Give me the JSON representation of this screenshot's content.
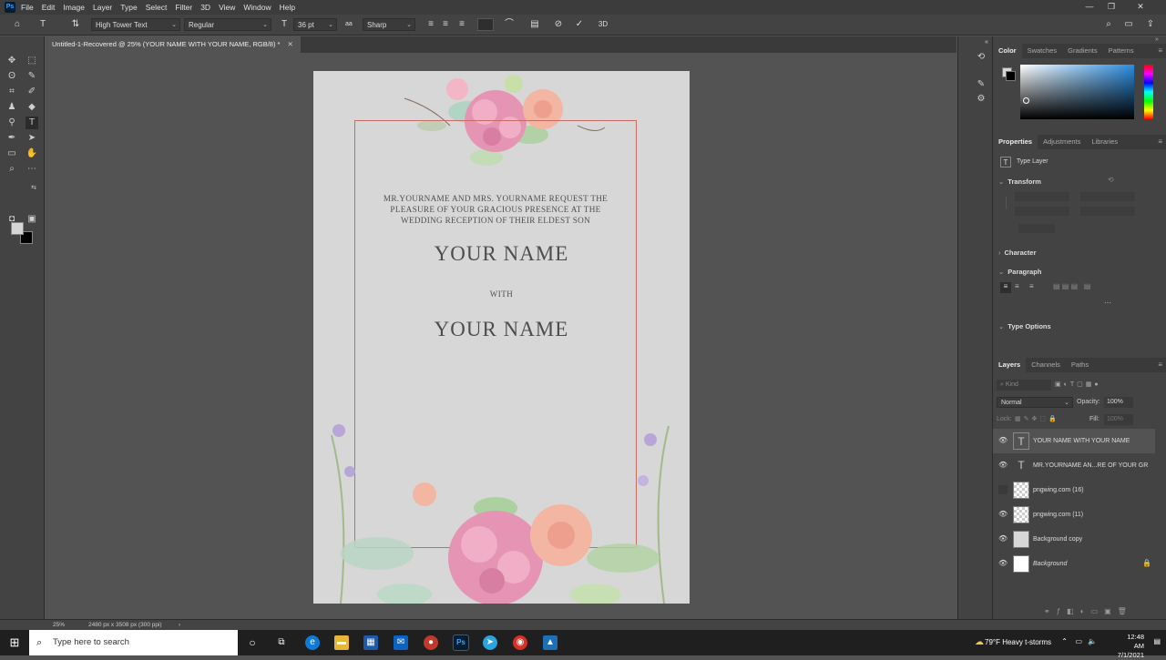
{
  "app": {
    "logo": "Ps"
  },
  "menu": [
    "File",
    "Edit",
    "Image",
    "Layer",
    "Type",
    "Select",
    "Filter",
    "3D",
    "View",
    "Window",
    "Help"
  ],
  "options": {
    "font_family": "High Tower Text",
    "font_style": "Regular",
    "font_size": "36 pt",
    "aa_label": "aa",
    "antialias": "Sharp"
  },
  "document": {
    "tab_title": "Untitled-1-Recovered @ 25% (YOUR NAME  WITH YOUR NAME, RGB/8) *",
    "invite_line1": "MR.YOURNAME AND MRS. YOURNAME REQUEST THE",
    "invite_line2": "PLEASURE OF YOUR GRACIOUS PRESENCE   AT THE",
    "invite_line3": "WEDDING RECEPTION OF THEIR ELDEST SON",
    "name1": "YOUR NAME",
    "with": "WITH",
    "name2": "YOUR NAME"
  },
  "panels": {
    "color_tabs": [
      "Color",
      "Swatches",
      "Gradients",
      "Patterns"
    ],
    "properties_tabs": [
      "Properties",
      "Adjustments",
      "Libraries"
    ],
    "type_layer_label": "Type Layer",
    "transform": "Transform",
    "character": "Character",
    "paragraph": "Paragraph",
    "type_options": "Type Options",
    "layers_tabs": [
      "Layers",
      "Channels",
      "Paths"
    ],
    "kind_placeholder": "Kind",
    "blend_mode": "Normal",
    "opacity_label": "Opacity:",
    "opacity": "100%",
    "lock_label": "Lock:",
    "fill_label": "Fill:",
    "fill": "100%"
  },
  "layers": [
    {
      "name": "YOUR NAME  WITH YOUR NAME",
      "kind": "type",
      "visible": true,
      "selected": true
    },
    {
      "name": "MR.YOURNAME AN...RE OF YOUR GR",
      "kind": "type",
      "visible": true,
      "selected": false
    },
    {
      "name": "pngwing.com (16)",
      "kind": "image",
      "visible": false,
      "selected": false
    },
    {
      "name": "pngwing.com (11)",
      "kind": "image",
      "visible": true,
      "selected": false
    },
    {
      "name": "Background copy",
      "kind": "fill",
      "visible": true,
      "selected": false
    },
    {
      "name": "Background",
      "kind": "background",
      "visible": true,
      "selected": false
    }
  ],
  "status": {
    "zoom": "25%",
    "doc_size": "2480 px x 3508 px (300 ppi)"
  },
  "taskbar": {
    "search_placeholder": "Type here to search",
    "weather": "79°F  Heavy t-storms",
    "time": "12:48 AM",
    "date": "7/1/2021"
  },
  "colors": {
    "accent": "#31a8ff",
    "frame_line": "#c86b63",
    "document_bg": "#d7d7d7"
  }
}
